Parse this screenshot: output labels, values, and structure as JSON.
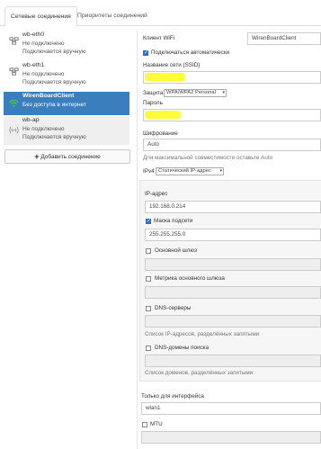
{
  "tabs": [
    {
      "label": "Сетевые соединения"
    },
    {
      "label": "Приоритеты соединений"
    }
  ],
  "connections": [
    {
      "name": "wb-eth0",
      "status": "Не подключено",
      "mode": "Подключается вручную",
      "icon": "ethernet-icon"
    },
    {
      "name": "wb-eth1",
      "status": "Не подключено",
      "mode": "Подключается вручную",
      "icon": "ethernet-icon"
    },
    {
      "name": "WirenBoardClient",
      "status": "Без доступа в интернет",
      "mode": "",
      "icon": "wifi-icon"
    },
    {
      "name": "wb-ap",
      "status": "Не подключено",
      "mode": "Подключается вручную",
      "icon": "wifi-ap-icon"
    }
  ],
  "add_connection_label": "Добавить соединение",
  "form": {
    "client_label": "Клиент WiFi",
    "client_value": "WirenBoardClient",
    "autoconnect_label": "Подключаться автоматически",
    "ssid_label": "Название сети (SSID)",
    "security_label": "Защита",
    "security_value": "WPA/WPA2 Personal",
    "password_label": "Пароль",
    "encryption_label": "Шифрование",
    "encryption_value": "Auto",
    "encryption_hint": "Для максимальной совместимости оставьте Auto",
    "ipv4_label": "IPv4",
    "ipv4_value": "Статический IP-адрес",
    "ip_label": "IP-адрес",
    "ip_value": "192.168.0.214",
    "mask_label": "Маска подсети",
    "mask_value": "255.255.255.0",
    "gateway_label": "Основной шлюз",
    "metric_label": "Метрика основного шлюза",
    "dns_label": "DNS-серверы",
    "dns_hint": "Список IP-адресов, разделённых запятыми",
    "dns_search_label": "DNS-домены поиска",
    "dns_search_hint": "Список доменов, разделённых запятыми",
    "iface_label": "Только для интерфейса",
    "iface_value": "wlan1",
    "mtu_label": "MTU"
  },
  "colors": {
    "selected": "#3a7ebd",
    "highlight": "#ffff33",
    "checkbox": "#2d6bd6"
  }
}
